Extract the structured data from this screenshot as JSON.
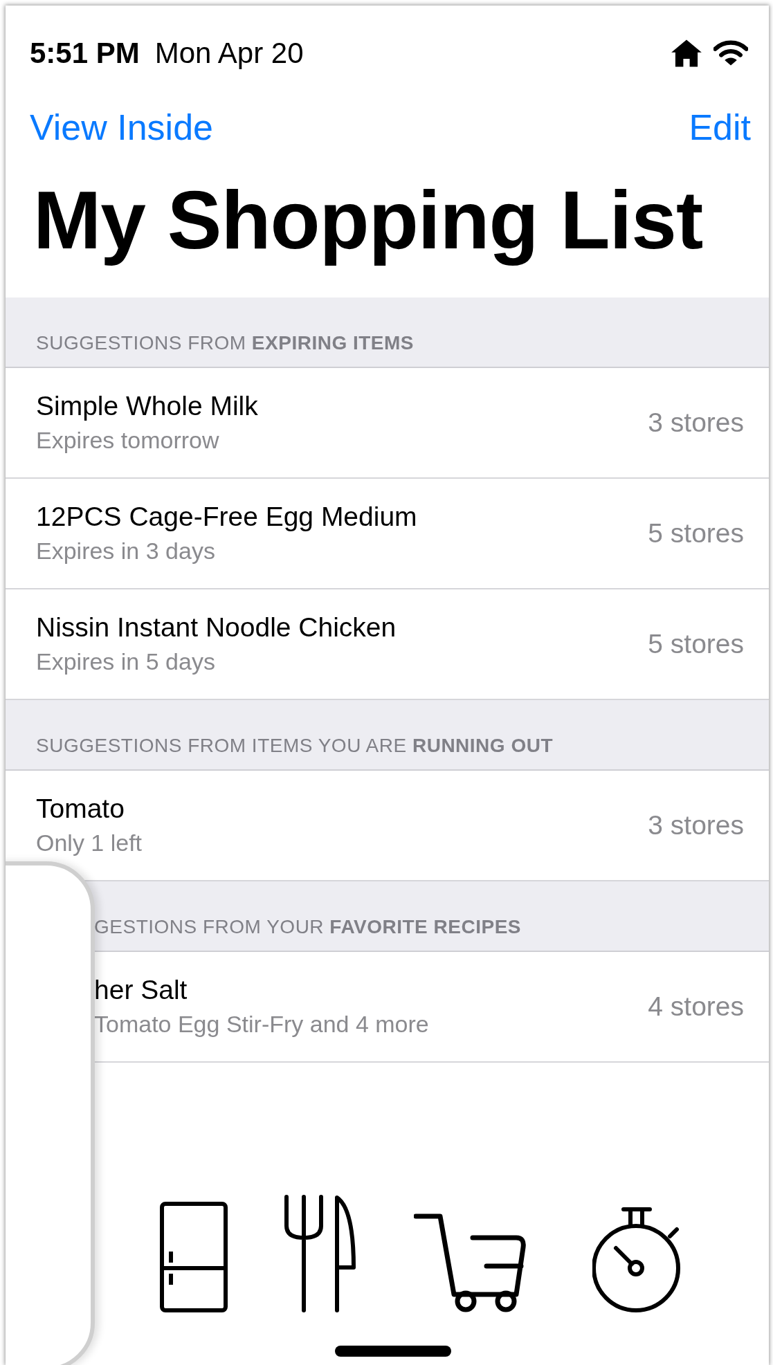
{
  "status_bar": {
    "time": "5:51 PM",
    "date": "Mon Apr 20"
  },
  "nav": {
    "left_button": "View Inside",
    "right_button": "Edit"
  },
  "title": "My Shopping List",
  "sections": [
    {
      "header": "SUGGESTIONS FROM **EXPIRING ITEMS**",
      "obscured": false,
      "items": [
        {
          "name": "Simple Whole Milk",
          "detail": "Expires tomorrow",
          "stores": "3 stores"
        },
        {
          "name": "12PCS Cage-Free Egg Medium",
          "detail": "Expires in 3 days",
          "stores": "5 stores"
        },
        {
          "name": "Nissin Instant Noodle Chicken",
          "detail": "Expires in 5 days",
          "stores": "5 stores"
        }
      ]
    },
    {
      "header": "SUGGESTIONS FROM ITEMS YOU ARE **RUNNING OUT**",
      "obscured": false,
      "items": [
        {
          "name": "Tomato",
          "detail": "Only 1 left",
          "stores": "3 stores"
        }
      ]
    },
    {
      "header": "GESTIONS FROM YOUR **FAVORITE RECIPES**",
      "obscured": true,
      "items": [
        {
          "name": "her Salt",
          "detail": "Tomato Egg Stir-Fry and 4 more",
          "stores": "4 stores"
        }
      ]
    }
  ],
  "tab_bar": {
    "items": [
      {
        "kind": "fridge"
      },
      {
        "kind": "utensils"
      },
      {
        "kind": "cart"
      },
      {
        "kind": "stopwatch"
      }
    ]
  }
}
